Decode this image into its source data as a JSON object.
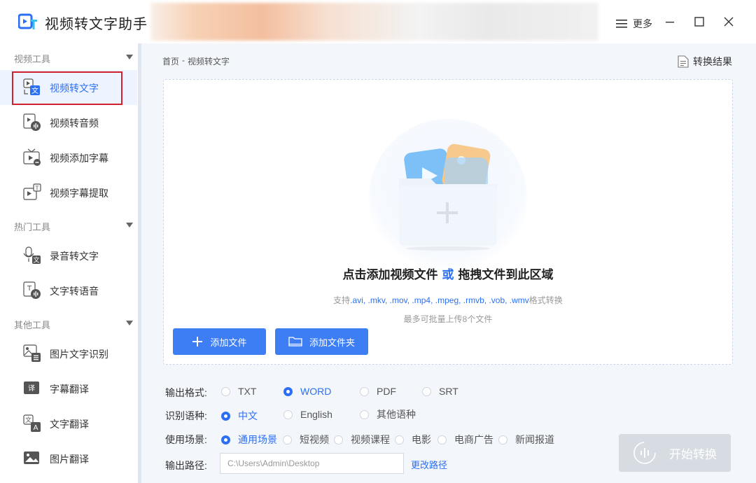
{
  "app": {
    "title": "视频转文字助手",
    "more_label": "更多"
  },
  "sidebar": {
    "groups": [
      {
        "title": "视频工具",
        "items": [
          "视频转文字",
          "视频转音频",
          "视频添加字幕",
          "视频字幕提取"
        ]
      },
      {
        "title": "热门工具",
        "items": [
          "录音转文字",
          "文字转语音"
        ]
      },
      {
        "title": "其他工具",
        "items": [
          "图片文字识别",
          "字幕翻译",
          "文字翻译",
          "图片翻译"
        ]
      }
    ],
    "active_item": "视频转文字"
  },
  "breadcrumb": {
    "home": "首页",
    "sep": "-",
    "current": "视频转文字"
  },
  "result_link": "转换结果",
  "dropzone": {
    "title_part1": "点击添加视频文件",
    "title_or": "或",
    "title_part2": "拖拽文件到此区域",
    "support_prefix": "支持",
    "support_exts": ".avi, .mkv, .mov, .mp4, .mpeg, .rmvb, .vob, .wmv",
    "support_suffix": "格式转换",
    "limit": "最多可批量上传8个文件"
  },
  "buttons": {
    "add_file": "添加文件",
    "add_folder": "添加文件夹",
    "start": "开始转换",
    "change_path": "更改路径"
  },
  "options": {
    "format": {
      "label": "输出格式:",
      "choices": [
        "TXT",
        "WORD",
        "PDF",
        "SRT"
      ],
      "selected": "WORD"
    },
    "language": {
      "label": "识别语种:",
      "choices": [
        "中文",
        "English",
        "其他语种"
      ],
      "selected": "中文"
    },
    "scene": {
      "label": "使用场景:",
      "choices": [
        "通用场景",
        "短视频",
        "视频课程",
        "电影",
        "电商广告",
        "新闻报道"
      ],
      "selected": "通用场景"
    },
    "path": {
      "label": "输出路径:",
      "value": "C:\\Users\\Admin\\Desktop"
    }
  },
  "colors": {
    "accent": "#2c6ff2",
    "button": "#3d7ef5",
    "highlight": "#d0212c",
    "disabled": "#d7dce3"
  }
}
